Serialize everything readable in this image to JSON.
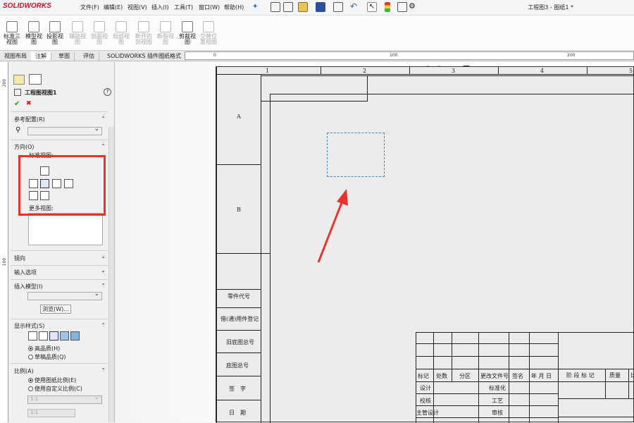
{
  "app": {
    "logo": "SOLIDWORKS",
    "doc_title": "工程图3 - 图纸1 *"
  },
  "menu": [
    "文件(F)",
    "编辑(E)",
    "视图(V)",
    "插入(I)",
    "工具(T)",
    "窗口(W)",
    "帮助(H)"
  ],
  "commands": [
    {
      "label": "标准三\n视图",
      "enabled": true
    },
    {
      "label": "模型视\n图",
      "enabled": true
    },
    {
      "label": "投影视\n图",
      "enabled": true
    },
    {
      "label": "辅助视\n图",
      "enabled": false
    },
    {
      "label": "剖面视\n图",
      "enabled": false
    },
    {
      "label": "局部视\n图",
      "enabled": false
    },
    {
      "label": "断开的\n剖视图",
      "enabled": false
    },
    {
      "label": "断裂视\n图",
      "enabled": false
    },
    {
      "label": "剪裁视\n图",
      "enabled": true
    },
    {
      "label": "交替位\n置视图",
      "enabled": false
    }
  ],
  "tabs": [
    "视图布局",
    "注解",
    "草图",
    "评估",
    "SOLIDWORKS 插件",
    "图纸格式"
  ],
  "ruler": {
    "h": [
      "0",
      "100",
      "200"
    ],
    "v": [
      "200",
      "100"
    ]
  },
  "panel": {
    "title": "工程图视图1",
    "help": "?",
    "ok": "✔",
    "cancel": "✖",
    "ref_config": "参考配置(R)",
    "orientation": "方向(O)",
    "standard_views": "标准视图:",
    "more_views": "更多视图:",
    "mirror": "镜向",
    "import_options": "输入选项",
    "insert_model": "插入模型(I)",
    "browse": "浏览(W)...",
    "display_style": "显示样式(S)",
    "hq": "高品质(H)",
    "draft": "草稿品质(Q)",
    "scale": "比例(A)",
    "use_sheet_scale": "使用图纸比例(E)",
    "use_custom_scale": "使用自定义比例(C)",
    "scale_value": "1:1",
    "scale_value2": "1:1"
  },
  "sheet": {
    "cols": [
      "1",
      "2",
      "3",
      "4",
      "5"
    ],
    "rows": [
      "A",
      "B"
    ],
    "left_labels": [
      "零件代号",
      "借(通)用件登记",
      "旧底图总号",
      "底图总号",
      "签　字",
      "日　期"
    ],
    "title_block": {
      "headers": [
        "标记",
        "处数",
        "分区",
        "更改文件号",
        "签名",
        "年 月 日"
      ],
      "row_labels": [
        "设计",
        "校核",
        "主管设计"
      ],
      "mid_labels": [
        "标准化",
        "工艺",
        "审核"
      ],
      "right_headers": [
        "阶 段 标 记",
        "质量",
        "比"
      ]
    }
  },
  "colors": {
    "annotation": "#e8322c",
    "highlight": "#e8322c",
    "preview_box": "#3a86d8"
  }
}
